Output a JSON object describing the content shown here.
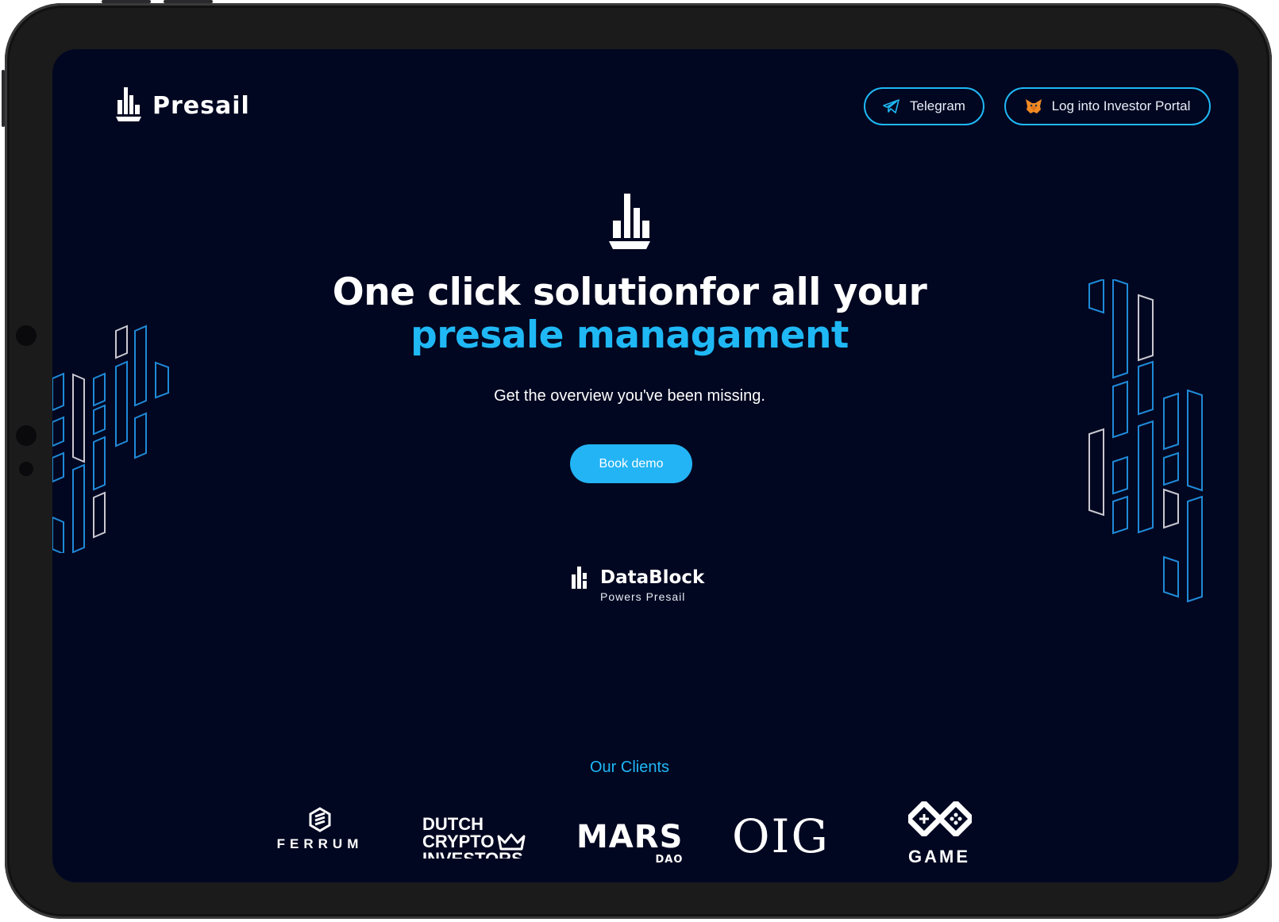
{
  "header": {
    "brand": "Presail",
    "telegram_label": "Telegram",
    "investor_label": "Log into Investor Portal"
  },
  "hero": {
    "headline_line1": "One click solutionfor all your",
    "headline_line2": "presale managament",
    "subline": "Get the overview you've been missing.",
    "cta_label": "Book demo"
  },
  "powered": {
    "title": "DataBlock",
    "subtitle": "Powers Presail"
  },
  "clients": {
    "title": "Our Clients",
    "items": [
      {
        "name": "FERRUM"
      },
      {
        "line1": "DUTCH",
        "line2": "CRYPTO",
        "line3": "INVESTORS"
      },
      {
        "name": "MARS",
        "sub": "DAO"
      },
      {
        "name": "OIG"
      },
      {
        "name": "GAME"
      }
    ]
  },
  "colors": {
    "background": "#020721",
    "accent": "#1fb8f5",
    "text": "#ffffff"
  },
  "icons": [
    "presail-logo-icon",
    "telegram-icon",
    "metamask-fox-icon",
    "datablock-logo-icon"
  ]
}
